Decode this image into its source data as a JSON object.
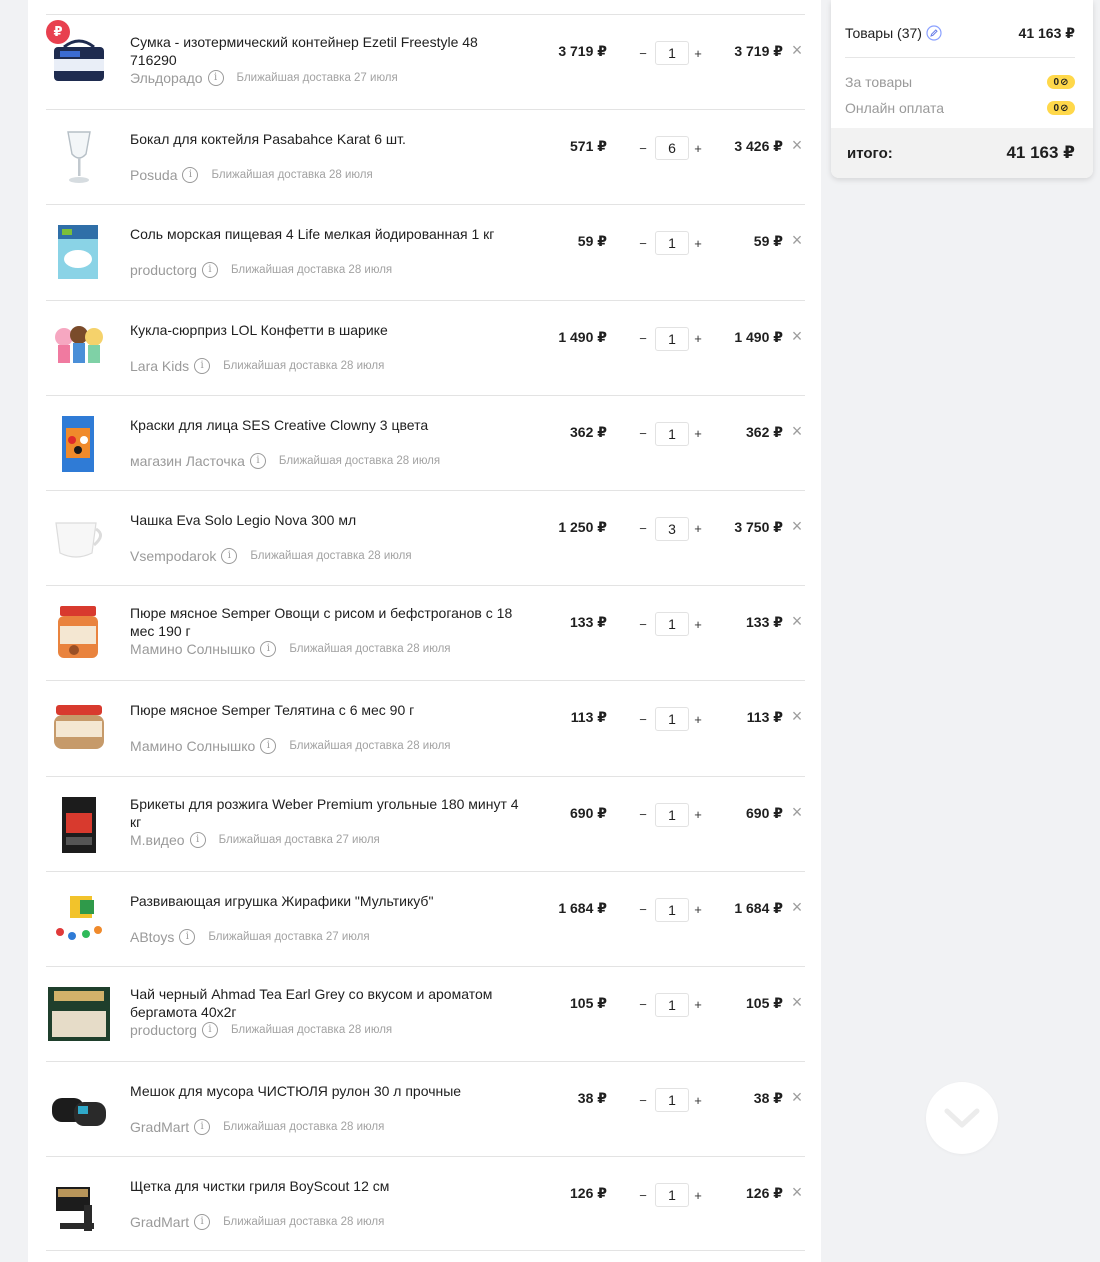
{
  "currency_sign": "₽",
  "cart": {
    "items": [
      {
        "title": "Сумка - изотермический контейнер Ezetil Freestyle 48 716290",
        "seller": "Эльдорадо",
        "delivery": "Ближайшая доставка 27 июля",
        "price": "3 719 ₽",
        "qty": "1",
        "total": "3 719 ₽",
        "badge": "₽",
        "icon": "cooler-bag-icon",
        "two_line": true
      },
      {
        "title": "Бокал для коктейля Pasabahce Karat 6 шт.",
        "seller": "Posuda",
        "delivery": "Ближайшая доставка 28 июля",
        "price": "571 ₽",
        "qty": "6",
        "total": "3 426 ₽",
        "icon": "wine-glass-icon",
        "two_line": false
      },
      {
        "title": "Соль морская пищевая 4 Life мелкая йодированная 1 кг",
        "seller": "productorg",
        "delivery": "Ближайшая доставка 28 июля",
        "price": "59 ₽",
        "qty": "1",
        "total": "59 ₽",
        "icon": "salt-package-icon",
        "two_line": false
      },
      {
        "title": "Кукла-сюрприз LOL Конфетти в шарике",
        "seller": "Lara Kids",
        "delivery": "Ближайшая доставка 28 июля",
        "price": "1 490 ₽",
        "qty": "1",
        "total": "1 490 ₽",
        "icon": "dolls-icon",
        "two_line": false
      },
      {
        "title": "Краски для лица SES Creative Clowny 3 цвета",
        "seller": "магазин Ласточка",
        "delivery": "Ближайшая доставка 28 июля",
        "price": "362 ₽",
        "qty": "1",
        "total": "362 ₽",
        "icon": "face-paint-icon",
        "two_line": false
      },
      {
        "title": "Чашка Eva Solo Legio Nova 300 мл",
        "seller": "Vsempodarok",
        "delivery": "Ближайшая доставка 28 июля",
        "price": "1 250 ₽",
        "qty": "3",
        "total": "3 750 ₽",
        "icon": "cup-icon",
        "two_line": false
      },
      {
        "title": "Пюре мясное Semper Овощи с рисом и бефстроганов с 18 мес 190 г",
        "seller": "Мамино Солнышко",
        "delivery": "Ближайшая доставка 28 июля",
        "price": "133 ₽",
        "qty": "1",
        "total": "133 ₽",
        "icon": "baby-food-jar-icon",
        "two_line": true
      },
      {
        "title": "Пюре мясное Semper Телятина с 6 мес 90 г",
        "seller": "Мамино Солнышко",
        "delivery": "Ближайшая доставка 28 июля",
        "price": "113 ₽",
        "qty": "1",
        "total": "113 ₽",
        "icon": "baby-food-jar-small-icon",
        "two_line": false
      },
      {
        "title": "Брикеты для розжига Weber Premium угольные 180 минут 4 кг",
        "seller": "М.видео",
        "delivery": "Ближайшая доставка 27 июля",
        "price": "690 ₽",
        "qty": "1",
        "total": "690 ₽",
        "icon": "charcoal-bag-icon",
        "two_line": true
      },
      {
        "title": "Развивающая игрушка Жирафики \"Мультикуб\"",
        "seller": "ABtoys",
        "delivery": "Ближайшая доставка 27 июля",
        "price": "1 684 ₽",
        "qty": "1",
        "total": "1 684 ₽",
        "icon": "toy-cube-icon",
        "two_line": false
      },
      {
        "title": "Чай черный Ahmad Tea Earl Grey со вкусом и ароматом бергамота 40x2г",
        "seller": "productorg",
        "delivery": "Ближайшая доставка 28 июля",
        "price": "105 ₽",
        "qty": "1",
        "total": "105 ₽",
        "icon": "tea-box-icon",
        "two_line": true
      },
      {
        "title": "Мешок для мусора ЧИСТЮЛЯ рулон 30 л прочные",
        "seller": "GradMart",
        "delivery": "Ближайшая доставка 28 июля",
        "price": "38 ₽",
        "qty": "1",
        "total": "38 ₽",
        "icon": "trash-bags-icon",
        "two_line": false
      },
      {
        "title": "Щетка для чистки гриля BoyScout 12 см",
        "seller": "GradMart",
        "delivery": "Ближайшая доставка 28 июля",
        "price": "126 ₽",
        "qty": "1",
        "total": "126 ₽",
        "icon": "grill-brush-icon",
        "two_line": false
      }
    ],
    "qty_minus": "−",
    "qty_plus": "+",
    "remove_glyph": "×",
    "info_glyph": "i"
  },
  "summary": {
    "items_label": "Товары (37)",
    "items_amount": "41 163 ₽",
    "for_goods_label": "За товары",
    "for_goods_bonus": "0",
    "online_pay_label": "Онлайн оплата",
    "online_pay_bonus": "0",
    "total_label": "итого:",
    "total_amount": "41 163 ₽",
    "bonus_color": "#ffd84a",
    "edit_icon": "pencil-circle-icon"
  },
  "scroll_button_icon": "chevron-down-icon"
}
